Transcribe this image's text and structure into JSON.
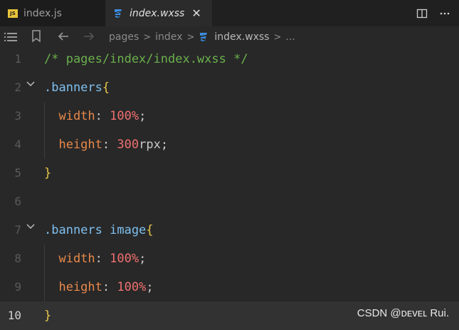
{
  "tabs": [
    {
      "icon": "js-file-icon",
      "badge": "JS",
      "label": "index.js"
    },
    {
      "icon": "css-file-icon",
      "label": "index.wxss",
      "close": "✕"
    }
  ],
  "breadcrumb": {
    "parts": [
      "pages",
      "index",
      "index.wxss",
      "..."
    ]
  },
  "editor": {
    "lines": [
      {
        "n": "1",
        "tokens": [
          {
            "t": "/* pages/index/index.wxss */",
            "c": "comment"
          }
        ]
      },
      {
        "n": "2",
        "fold": true,
        "tokens": [
          {
            "t": ".banners",
            "c": "sel"
          },
          {
            "t": "{",
            "c": "brace"
          }
        ]
      },
      {
        "n": "3",
        "indent": true,
        "tokens": [
          {
            "t": "  width",
            "c": "prop"
          },
          {
            "t": ": ",
            "c": "punc"
          },
          {
            "t": "100%",
            "c": "num"
          },
          {
            "t": ";",
            "c": "punc"
          }
        ]
      },
      {
        "n": "4",
        "indent": true,
        "tokens": [
          {
            "t": "  height",
            "c": "prop"
          },
          {
            "t": ": ",
            "c": "punc"
          },
          {
            "t": "300",
            "c": "num"
          },
          {
            "t": "rpx",
            "c": "unit"
          },
          {
            "t": ";",
            "c": "punc"
          }
        ]
      },
      {
        "n": "5",
        "tokens": [
          {
            "t": "}",
            "c": "brace"
          }
        ]
      },
      {
        "n": "6",
        "tokens": []
      },
      {
        "n": "7",
        "fold": true,
        "tokens": [
          {
            "t": ".banners image",
            "c": "sel"
          },
          {
            "t": "{",
            "c": "brace"
          }
        ]
      },
      {
        "n": "8",
        "indent": true,
        "tokens": [
          {
            "t": "  width",
            "c": "prop"
          },
          {
            "t": ": ",
            "c": "punc"
          },
          {
            "t": "100%",
            "c": "num"
          },
          {
            "t": ";",
            "c": "punc"
          }
        ]
      },
      {
        "n": "9",
        "indent": true,
        "tokens": [
          {
            "t": "  height",
            "c": "prop"
          },
          {
            "t": ": ",
            "c": "punc"
          },
          {
            "t": "100%",
            "c": "num"
          },
          {
            "t": ";",
            "c": "punc"
          }
        ]
      },
      {
        "n": "10",
        "current": true,
        "tokens": [
          {
            "t": "}",
            "c": "brace"
          }
        ]
      }
    ]
  },
  "watermark": "CSDN @ᴅᴇᴠᴇʟ Rui."
}
